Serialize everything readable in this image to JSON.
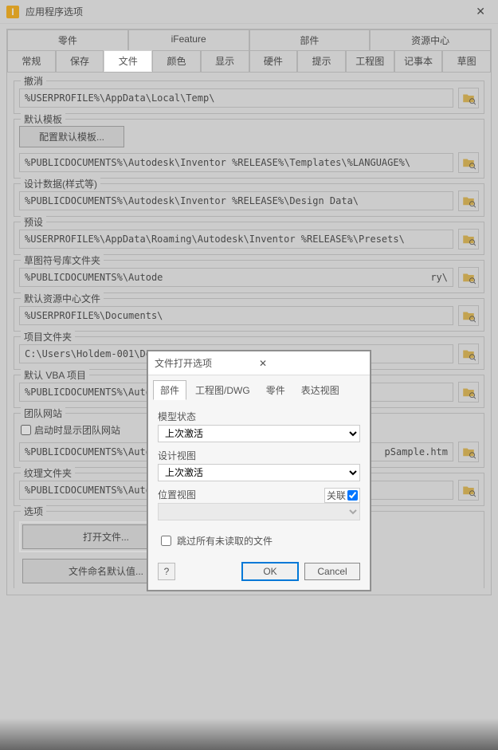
{
  "window": {
    "title": "应用程序选项"
  },
  "tabs_row1": [
    "零件",
    "iFeature",
    "部件",
    "资源中心"
  ],
  "tabs_row2": [
    "常规",
    "保存",
    "文件",
    "颜色",
    "显示",
    "硬件",
    "提示",
    "工程图",
    "记事本",
    "草图"
  ],
  "active_tab": "文件",
  "groups": {
    "undo": {
      "label": "撤消",
      "path": "%USERPROFILE%\\AppData\\Local\\Temp\\"
    },
    "template": {
      "label": "默认模板",
      "btn": "配置默认模板...",
      "path": "%PUBLICDOCUMENTS%\\Autodesk\\Inventor %RELEASE%\\Templates\\%LANGUAGE%\\"
    },
    "design": {
      "label": "设计数据(样式等)",
      "path": "%PUBLICDOCUMENTS%\\Autodesk\\Inventor %RELEASE%\\Design Data\\"
    },
    "preset": {
      "label": "预设",
      "path": "%USERPROFILE%\\AppData\\Roaming\\Autodesk\\Inventor %RELEASE%\\Presets\\"
    },
    "symbol": {
      "label": "草图符号库文件夹",
      "path": "%PUBLICDOCUMENTS%\\Autode",
      "tail": "ry\\"
    },
    "content": {
      "label": "默认资源中心文件",
      "path": "%USERPROFILE%\\Documents\\"
    },
    "project": {
      "label": "项目文件夹",
      "path": "C:\\Users\\Holdem-001\\Docu"
    },
    "vba": {
      "label": "默认 VBA 项目",
      "path": "%PUBLICDOCUMENTS%\\Autode"
    },
    "team": {
      "label": "团队网站",
      "checkbox": "启动时显示团队网站",
      "path": "%PUBLICDOCUMENTS%\\Autode",
      "tail": "pSample.htm"
    },
    "texture": {
      "label": "纹理文件夹",
      "path": "%PUBLICDOCUMENTS%\\Autodesk\\Inventor %RELEASE%\\Textures\\"
    },
    "options": {
      "label": "选项",
      "open_btn": "打开文件...",
      "naming_btn": "文件命名默认值..."
    }
  },
  "modal": {
    "title": "文件打开选项",
    "tabs": [
      "部件",
      "工程图/DWG",
      "零件",
      "表达视图"
    ],
    "active_tab": "部件",
    "model_state_label": "模型状态",
    "model_state_value": "上次激活",
    "design_view_label": "设计视图",
    "design_view_value": "上次激活",
    "assoc_label": "关联",
    "position_view_label": "位置视图",
    "skip_unread_label": "跳过所有未读取的文件",
    "ok": "OK",
    "cancel": "Cancel"
  }
}
